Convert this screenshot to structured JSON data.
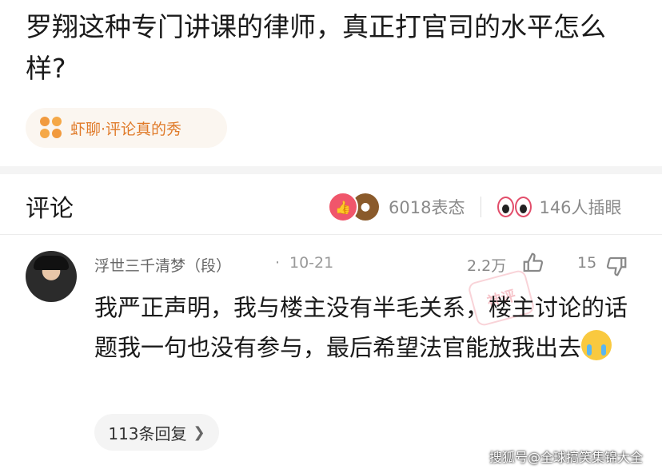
{
  "post": {
    "title": "罗翔这种专门讲课的律师，真正打官司的水平怎么样?",
    "topic": "虾聊·评论真的秀"
  },
  "comments_header": {
    "heading": "评论",
    "reaction_count": "6018表态",
    "peek_count": "146人插眼"
  },
  "comment": {
    "user_name": "浮世三千清梦（段）",
    "separator": "·",
    "date": "10-21",
    "like_count": "2.2万",
    "dislike_count": "15",
    "text": "我严正声明，我与楼主没有半毛关系，楼主讨论的话题我一句也没有参与，最后希望法官能放我出去",
    "reply_label": "113条回复",
    "stamp_text": "神评"
  },
  "watermark": "搜狐号@全球搞笑集锦大全",
  "colors": {
    "topic_accent": "#e07b2a",
    "like_reaction": "#f0566b",
    "eyes_accent": "#e24d6a"
  }
}
